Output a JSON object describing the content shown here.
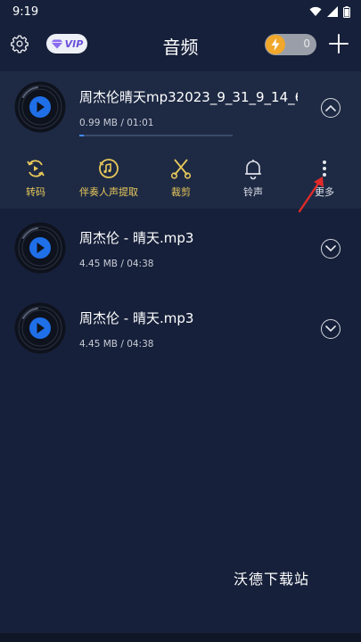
{
  "status_bar": {
    "time": "9:19"
  },
  "header": {
    "title": "音频",
    "vip_label": "VIP",
    "coin_count": "0"
  },
  "tracks": [
    {
      "title": "周杰伦晴天mp32023_9_31_9_14_6...",
      "meta": "0.99 MB / 01:01",
      "expanded": true,
      "progress": 0.03
    },
    {
      "title": "周杰伦 - 晴天.mp3",
      "meta": "4.45 MB / 04:38",
      "expanded": false
    },
    {
      "title": "周杰伦 - 晴天.mp3",
      "meta": "4.45 MB / 04:38",
      "expanded": false
    }
  ],
  "actions": [
    {
      "label": "转码",
      "icon": "convert-icon"
    },
    {
      "label": "伴奏人声提取",
      "icon": "vocal-extract-icon"
    },
    {
      "label": "裁剪",
      "icon": "scissors-icon"
    },
    {
      "label": "铃声",
      "icon": "bell-icon"
    },
    {
      "label": "更多",
      "icon": "more-vertical-icon"
    }
  ],
  "colors": {
    "background": "#16203a",
    "card": "#1e2a44",
    "accent_yellow": "#e8c85a",
    "accent_blue": "#3f8cff",
    "annotation_red": "#e02a2a"
  },
  "watermark": "沃德下载站"
}
